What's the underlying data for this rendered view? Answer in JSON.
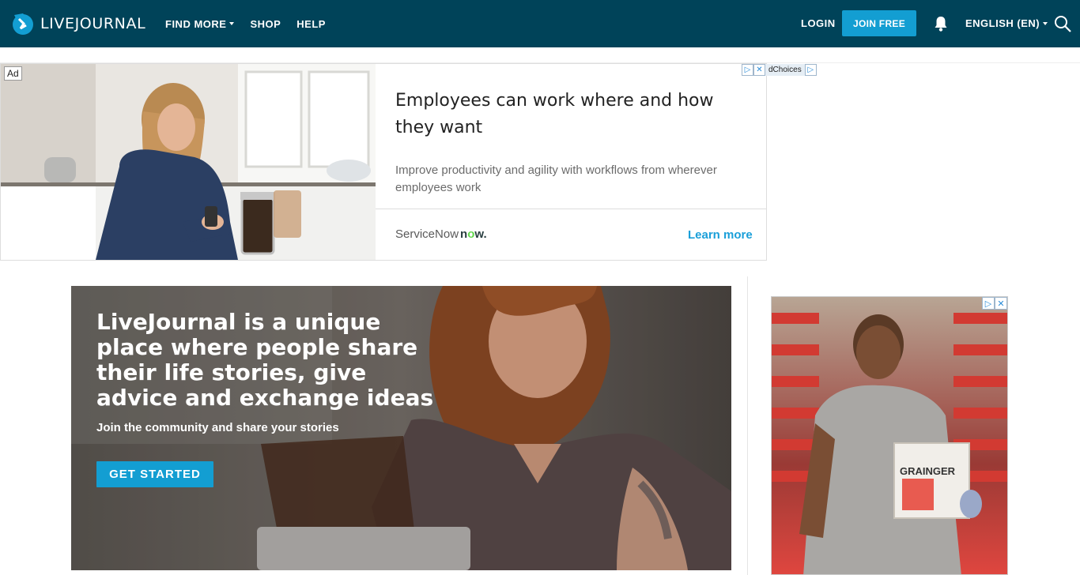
{
  "header": {
    "logo_text": "LIVEJOURNAL",
    "nav": [
      {
        "label": "FIND MORE",
        "has_caret": true
      },
      {
        "label": "SHOP",
        "has_caret": false
      },
      {
        "label": "HELP",
        "has_caret": false
      }
    ],
    "login_label": "LOGIN",
    "join_label": "JOIN FREE",
    "language_label": "ENGLISH (EN)"
  },
  "top_ad": {
    "ad_tag": "Ad",
    "headline": "Employees can work where and how they want",
    "body": "Improve productivity and agility with workflows from wherever employees work",
    "brand": "ServiceNow",
    "brand_logo_n": "n",
    "brand_logo_o": "o",
    "brand_logo_w": "w.",
    "cta": "Learn more",
    "adchoices_label": "dChoices"
  },
  "hero": {
    "title": "LiveJournal is a unique place where people share their life stories, give advice and exchange ideas",
    "subtitle": "Join the community and share your stories",
    "cta": "GET STARTED"
  },
  "side_ad": {
    "box_label": "GRAINGER"
  },
  "colors": {
    "header_bg": "#004359",
    "accent": "#139ed2",
    "link": "#1a9fd9"
  },
  "icons": [
    "livejournal-logo-icon",
    "bell-icon",
    "search-icon",
    "adchoices-icon",
    "close-icon"
  ]
}
